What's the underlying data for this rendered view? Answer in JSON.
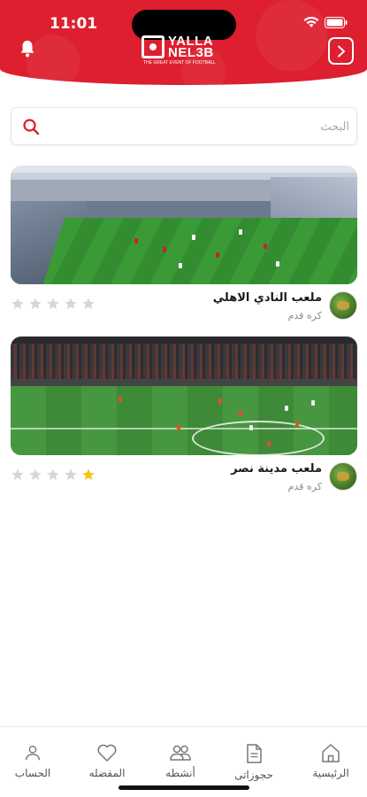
{
  "status_bar": {
    "time": "11:01"
  },
  "header": {
    "logo_line1": "YALLA",
    "logo_line2": "NEL3B",
    "logo_tagline": "THE GREAT EVENT OF FOOTBALL",
    "brand_color": "#dd1f2f",
    "left_icon": "bell-icon",
    "right_icon": "chevron-right-icon"
  },
  "search": {
    "placeholder": "البحث",
    "value": ""
  },
  "venues": [
    {
      "name": "ملعب النادي الاهلي",
      "type": "كره قدم",
      "rating": 0,
      "max_rating": 5
    },
    {
      "name": "ملعب مدينة نصر",
      "type": "كره قدم",
      "rating": 1,
      "max_rating": 5
    }
  ],
  "bottom_nav": [
    {
      "label": "الحساب",
      "icon": "user-icon"
    },
    {
      "label": "المفضله",
      "icon": "heart-icon"
    },
    {
      "label": "أنشطه",
      "icon": "people-icon"
    },
    {
      "label": "حجوزاتى",
      "icon": "document-icon"
    },
    {
      "label": "الرئيسية",
      "icon": "home-icon"
    }
  ],
  "colors": {
    "accent": "#dd1f2f",
    "star_active": "#f5c518",
    "star_inactive": "#d6d6d6"
  }
}
